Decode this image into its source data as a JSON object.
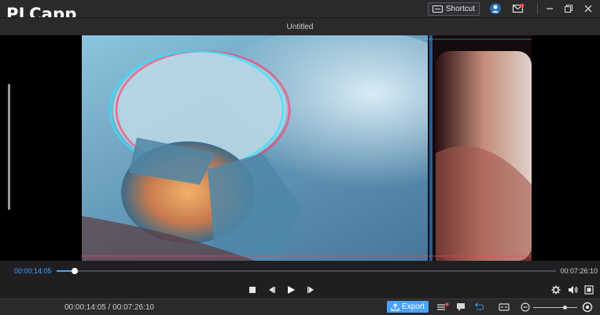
{
  "app": {
    "logo_text": "PLCapp"
  },
  "titlebar": {
    "shortcut_label": "Shortcut",
    "icons": [
      "keyboard-icon",
      "account-icon",
      "message-icon",
      "minimize-icon",
      "restore-icon",
      "close-icon"
    ]
  },
  "document": {
    "title": "Untitled"
  },
  "player": {
    "current_time": "00:00:14:05",
    "total_time": "00:07:26:10",
    "progress_fraction": 0.036,
    "controls": [
      "stop-icon",
      "previous-frame-icon",
      "play-icon",
      "next-frame-icon",
      "settings-icon",
      "volume-icon",
      "fullscreen-icon"
    ]
  },
  "bottombar": {
    "time_display": "00:00:14:05 / 00:07:26:10",
    "export_label": "Export",
    "zoom_level_fraction": 0.72,
    "accent_color": "#4aa3ff",
    "notification_color": "#ff4d4d"
  }
}
